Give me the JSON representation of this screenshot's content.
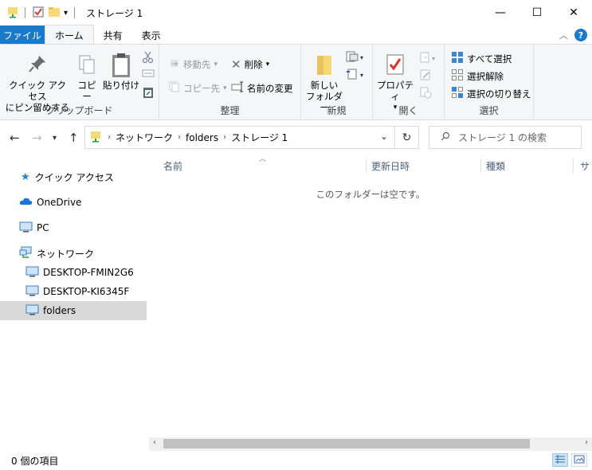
{
  "window": {
    "title": "ストレージ 1",
    "controls": {
      "minimize": "—",
      "maximize": "☐",
      "close": "✕"
    }
  },
  "ribbon_tabs": [
    {
      "label": "ファイル"
    },
    {
      "label": "ホーム"
    },
    {
      "label": "共有"
    },
    {
      "label": "表示"
    }
  ],
  "ribbon": {
    "clipboard": {
      "label": "クリップボード",
      "pin_line1": "クイック アクセス",
      "pin_line2": "にピン留めする",
      "copy": "コピー",
      "paste": "貼り付け"
    },
    "organize": {
      "label": "整理",
      "move_to": "移動先",
      "copy_to": "コピー先",
      "delete": "削除",
      "rename": "名前の変更"
    },
    "new": {
      "label": "新規",
      "new_folder_line1": "新しい",
      "new_folder_line2": "フォルダー"
    },
    "open": {
      "label": "開く",
      "properties": "プロパティ"
    },
    "select": {
      "label": "選択",
      "select_all": "すべて選択",
      "select_none": "選択解除",
      "invert": "選択の切り替え"
    }
  },
  "address": {
    "crumbs": [
      "ネットワーク",
      "folders",
      "ストレージ 1"
    ]
  },
  "search": {
    "placeholder": "ストレージ 1 の検索"
  },
  "nav_pane": {
    "quick_access": "クイック アクセス",
    "onedrive": "OneDrive",
    "pc": "PC",
    "network": "ネットワーク",
    "computers": [
      "DESKTOP-FMIN2G6",
      "DESKTOP-KI6345F",
      "folders"
    ]
  },
  "columns": [
    "名前",
    "更新日時",
    "種類",
    "サ"
  ],
  "empty_message": "このフォルダーは空です。",
  "status": {
    "item_count": "0 個の項目"
  },
  "colors": {
    "accent": "#1979ca",
    "folder": "#f8d775",
    "selection": "#d9d9d9"
  }
}
